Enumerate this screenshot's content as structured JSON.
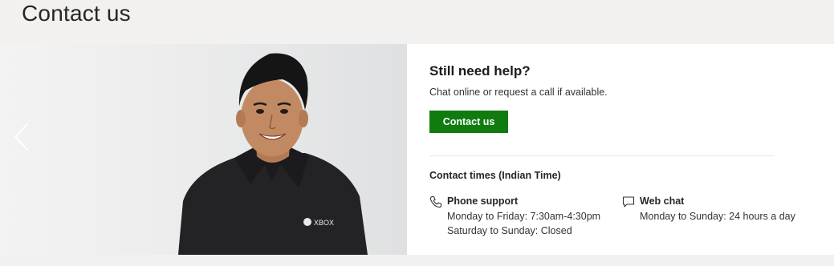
{
  "page": {
    "title": "Contact us"
  },
  "hero": {
    "shirt_logo_text": "XBOX",
    "prev_arrow_icon": "chevron-left-icon"
  },
  "help": {
    "heading": "Still need help?",
    "description": "Chat online or request a call if available.",
    "button_label": "Contact us",
    "button_color": "#107c10"
  },
  "contact_times": {
    "heading": "Contact times (Indian Time)",
    "phone": {
      "icon": "phone-icon",
      "label": "Phone support",
      "lines": [
        "Monday to Friday: 7:30am-4:30pm",
        "Saturday to Sunday: Closed"
      ]
    },
    "chat": {
      "icon": "chat-icon",
      "label": "Web chat",
      "lines": [
        "Monday to Sunday: 24 hours a day"
      ]
    }
  }
}
